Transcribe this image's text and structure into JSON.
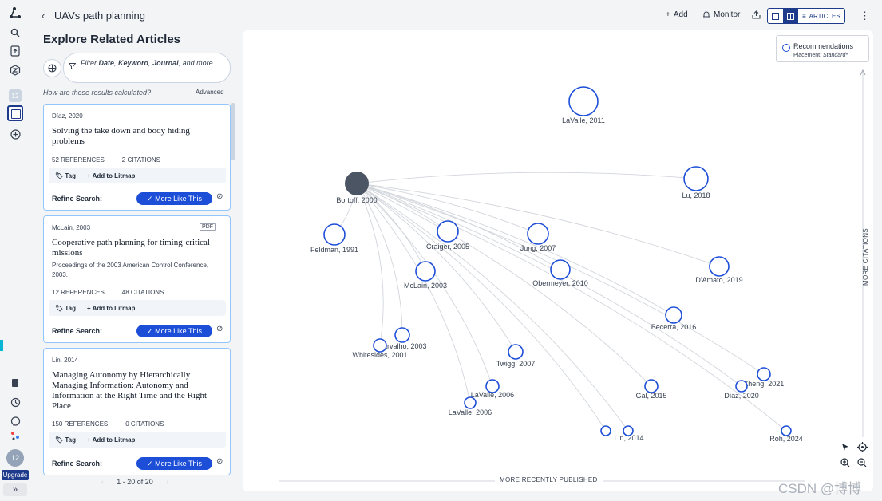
{
  "rail": {
    "badge_count": "12",
    "avatar_label": "12",
    "upgrade_label": "Upgrade",
    "expand_label": "»"
  },
  "header": {
    "back": "‹",
    "title": "UAVs path planning",
    "add_label": "Add",
    "monitor_label": "Monitor",
    "articles_label": "ARTICLES",
    "kebab": "⋮"
  },
  "panel": {
    "title": "Explore Related Articles",
    "filter_prefix": "Filter ",
    "filter_date": "Date",
    "filter_sep1": ", ",
    "filter_keyword": "Keyword",
    "filter_sep2": ", ",
    "filter_journal": "Journal",
    "filter_suffix": ", and more…",
    "how_text": "How are these results calculated?",
    "advanced_label": "Advanced",
    "pager_text": "1 - 20 of 20",
    "pager_prev": "‹",
    "pager_next": "›"
  },
  "cards": [
    {
      "meta": "Díaz, 2020",
      "title": "Solving the take down and body hiding problems",
      "venue": "",
      "references": "52  REFERENCES",
      "citations": "2  CITATIONS",
      "tag": "Tag",
      "add": "+  Add to Litmap",
      "refine": "Refine Search:",
      "more": "✓  More Like This",
      "pdf": ""
    },
    {
      "meta": "McLain, 2003",
      "title": "Cooperative path planning for timing-critical missions",
      "venue": "Proceedings of the 2003 American Control Conference, 2003.",
      "references": "12  REFERENCES",
      "citations": "48  CITATIONS",
      "tag": "Tag",
      "add": "+  Add to Litmap",
      "refine": "Refine Search:",
      "more": "✓  More Like This",
      "pdf": "PDF"
    },
    {
      "meta": "Lin, 2014",
      "title": "Managing Autonomy by Hierarchically Managing Information: Autonomy and Information at the Right Time and the Right Place",
      "venue": "",
      "references": "150  REFERENCES",
      "citations": "0  CITATIONS",
      "tag": "Tag",
      "add": "+  Add to Litmap",
      "refine": "Refine Search:",
      "more": "✓  More Like This",
      "pdf": ""
    }
  ],
  "graph": {
    "legend_label": "Recommendations",
    "placement_label": "Placement: ",
    "placement_value": "Standard*",
    "y_axis_label": "MORE CITATIONS",
    "x_axis_label": "MORE RECENTLY PUBLISHED",
    "accent": "#1d4ed8",
    "source_color": "#4b5563",
    "nodes": [
      {
        "label": "Bortoff, 2000",
        "source": true
      },
      {
        "label": "LaValle, 2011"
      },
      {
        "label": "Lu, 2018"
      },
      {
        "label": "Feldman, 1991"
      },
      {
        "label": "Craiger, 2005"
      },
      {
        "label": "Jung, 2007"
      },
      {
        "label": "McLain, 2003"
      },
      {
        "label": "Obermeyer, 2010"
      },
      {
        "label": "D'Amato, 2019"
      },
      {
        "label": "Becerra, 2016"
      },
      {
        "label": "Carvalho, 2003"
      },
      {
        "label": "Whitesides, 2001"
      },
      {
        "label": "Twigg, 2007"
      },
      {
        "label": "LaValle, 2006"
      },
      {
        "label": "LaValle, 2006"
      },
      {
        "label": "Gal, 2015"
      },
      {
        "label": "Zheng, 2021"
      },
      {
        "label": "Díaz, 2020"
      },
      {
        "label": "Lin, 2014"
      },
      {
        "label": ""
      },
      {
        "label": "Roh, 2024"
      }
    ]
  },
  "watermark": "CSDN @博博"
}
